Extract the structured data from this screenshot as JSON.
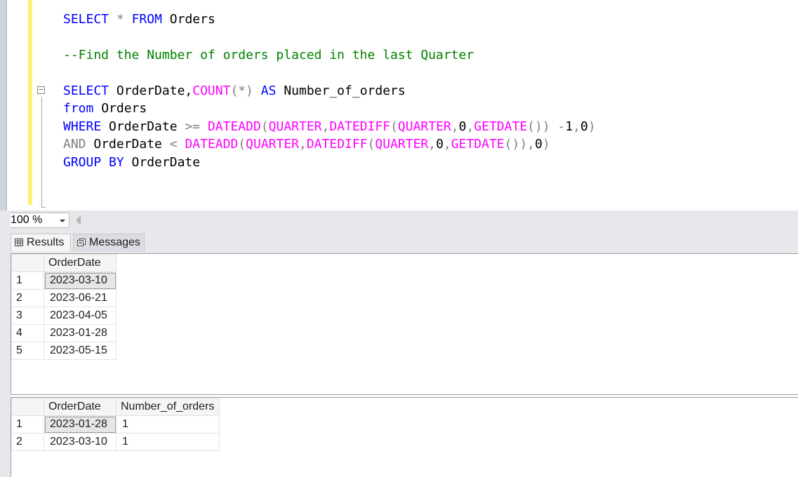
{
  "editor": {
    "line1": {
      "select": "SELECT",
      "star": "*",
      "from": "FROM",
      "table": "Orders"
    },
    "comment": "--Find the Number of orders placed in the last Quarter",
    "q_select": "SELECT",
    "q_cols_a": "OrderDate,",
    "q_count": "COUNT",
    "q_count_args": "(*)",
    "q_as": "AS",
    "q_alias": "Number_of_orders",
    "q_from": "from",
    "q_from_table": "Orders",
    "q_where": "WHERE",
    "q_where_col": "OrderDate",
    "q_ge": ">=",
    "q_and": "AND",
    "q_and_col": "OrderDate",
    "q_lt": "<",
    "q_group": "GROUP BY",
    "q_group_col": "OrderDate",
    "fn_dateadd": "DATEADD",
    "fn_quarter": "QUARTER",
    "fn_datediff": "DATEDIFF",
    "fn_getdate": "GETDATE",
    "collapse_glyph": "−"
  },
  "zoom": {
    "value": "100 %"
  },
  "tabs": {
    "results": "Results",
    "messages": "Messages"
  },
  "result1": {
    "columns": [
      "OrderDate"
    ],
    "rows": [
      {
        "n": "1",
        "date": "2023-03-10"
      },
      {
        "n": "2",
        "date": "2023-06-21"
      },
      {
        "n": "3",
        "date": "2023-04-05"
      },
      {
        "n": "4",
        "date": "2023-01-28"
      },
      {
        "n": "5",
        "date": "2023-05-15"
      }
    ]
  },
  "result2": {
    "columns": [
      "OrderDate",
      "Number_of_orders"
    ],
    "rows": [
      {
        "n": "1",
        "date": "2023-01-28",
        "count": "1"
      },
      {
        "n": "2",
        "date": "2023-03-10",
        "count": "1"
      }
    ]
  }
}
